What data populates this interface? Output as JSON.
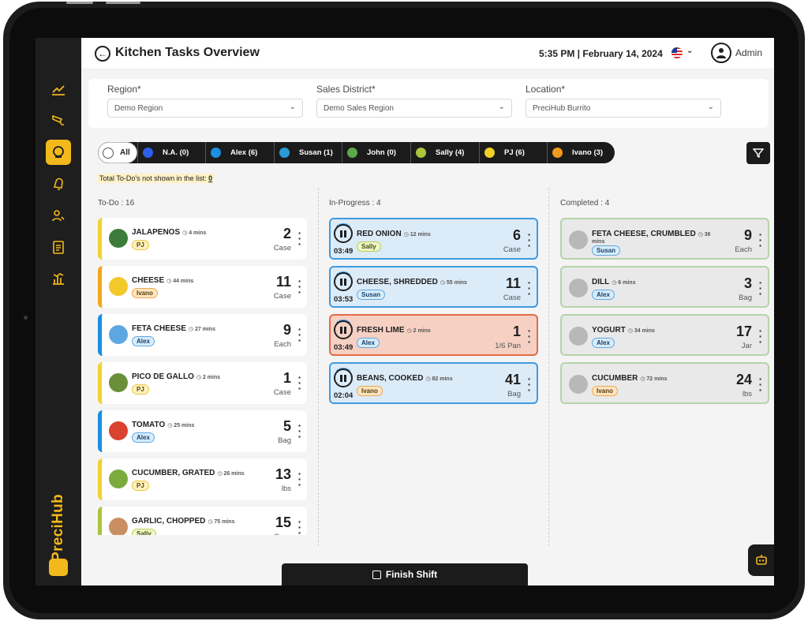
{
  "header": {
    "title": "Kitchen Tasks Overview",
    "datetime": "5:35 PM | February 14, 2024",
    "user": "Admin"
  },
  "filters": {
    "region": {
      "label": "Region*",
      "value": "Demo Region"
    },
    "district": {
      "label": "Sales District*",
      "value": "Demo Sales Region"
    },
    "location": {
      "label": "Location*",
      "value": "PreciHub Burrito"
    }
  },
  "staff": {
    "all_label": "All",
    "chips": [
      {
        "label": "N.A. (0)",
        "color": "#2f5fe8"
      },
      {
        "label": "Alex (6)",
        "color": "#1b8fe0"
      },
      {
        "label": "Susan (1)",
        "color": "#2a9bd6"
      },
      {
        "label": "John (0)",
        "color": "#5aa84a"
      },
      {
        "label": "Sally (4)",
        "color": "#a9c53b"
      },
      {
        "label": "PJ (6)",
        "color": "#f3cf2a"
      },
      {
        "label": "Ivano (3)",
        "color": "#f39a1e"
      }
    ]
  },
  "total_note": {
    "label": "Total To-Do's not shown in the list: ",
    "value": "0"
  },
  "columns": {
    "todo": {
      "title": "To-Do : 16"
    },
    "progress": {
      "title": "In-Progress : 4"
    },
    "done": {
      "title": "Completed : 4"
    }
  },
  "todo_cards": [
    {
      "name": "JALAPENOS",
      "time": "4 mins",
      "tag": "PJ",
      "qty": "2",
      "unit": "Case"
    },
    {
      "name": "CHEESE",
      "time": "44 mins",
      "tag": "Ivano",
      "qty": "11",
      "unit": "Case"
    },
    {
      "name": "FETA CHEESE",
      "time": "27 mins",
      "tag": "Alex",
      "qty": "9",
      "unit": "Each"
    },
    {
      "name": "PICO DE GALLO",
      "time": "2 mins",
      "tag": "PJ",
      "qty": "1",
      "unit": "Case"
    },
    {
      "name": "TOMATO",
      "time": "25 mins",
      "tag": "Alex",
      "qty": "5",
      "unit": "Bag"
    },
    {
      "name": "CUCUMBER, GRATED",
      "time": "26 mins",
      "tag": "PJ",
      "qty": "13",
      "unit": "lbs"
    },
    {
      "name": "GARLIC, CHOPPED",
      "time": "75 mins",
      "tag": "Sally",
      "qty": "15",
      "unit": "Case"
    }
  ],
  "progress_cards": [
    {
      "name": "RED ONION",
      "time": "12 mins",
      "tag": "Sally",
      "qty": "6",
      "unit": "Case",
      "timer": "03:49"
    },
    {
      "name": "CHEESE, SHREDDED",
      "time": "55 mins",
      "tag": "Susan",
      "qty": "11",
      "unit": "Case",
      "timer": "03:53"
    },
    {
      "name": "FRESH LIME",
      "time": "2 mins",
      "tag": "Alex",
      "qty": "1",
      "unit": "1/6 Pan",
      "timer": "03:49"
    },
    {
      "name": "BEANS, COOKED",
      "time": "82 mins",
      "tag": "Ivano",
      "qty": "41",
      "unit": "Bag",
      "timer": "02:04"
    }
  ],
  "done_cards": [
    {
      "name": "FETA CHEESE, CRUMBLED",
      "time": "36",
      "time2": "mins",
      "tag": "Susan",
      "qty": "9",
      "unit": "Each"
    },
    {
      "name": "DILL",
      "time": "6 mins",
      "tag": "Alex",
      "qty": "3",
      "unit": "Bag"
    },
    {
      "name": "YOGURT",
      "time": "34 mins",
      "tag": "Alex",
      "qty": "17",
      "unit": "Jar"
    },
    {
      "name": "CUCUMBER",
      "time": "72 mins",
      "tag": "Ivano",
      "qty": "24",
      "unit": "lbs"
    }
  ],
  "brand": "PreciHub",
  "finish_label": "Finish Shift"
}
